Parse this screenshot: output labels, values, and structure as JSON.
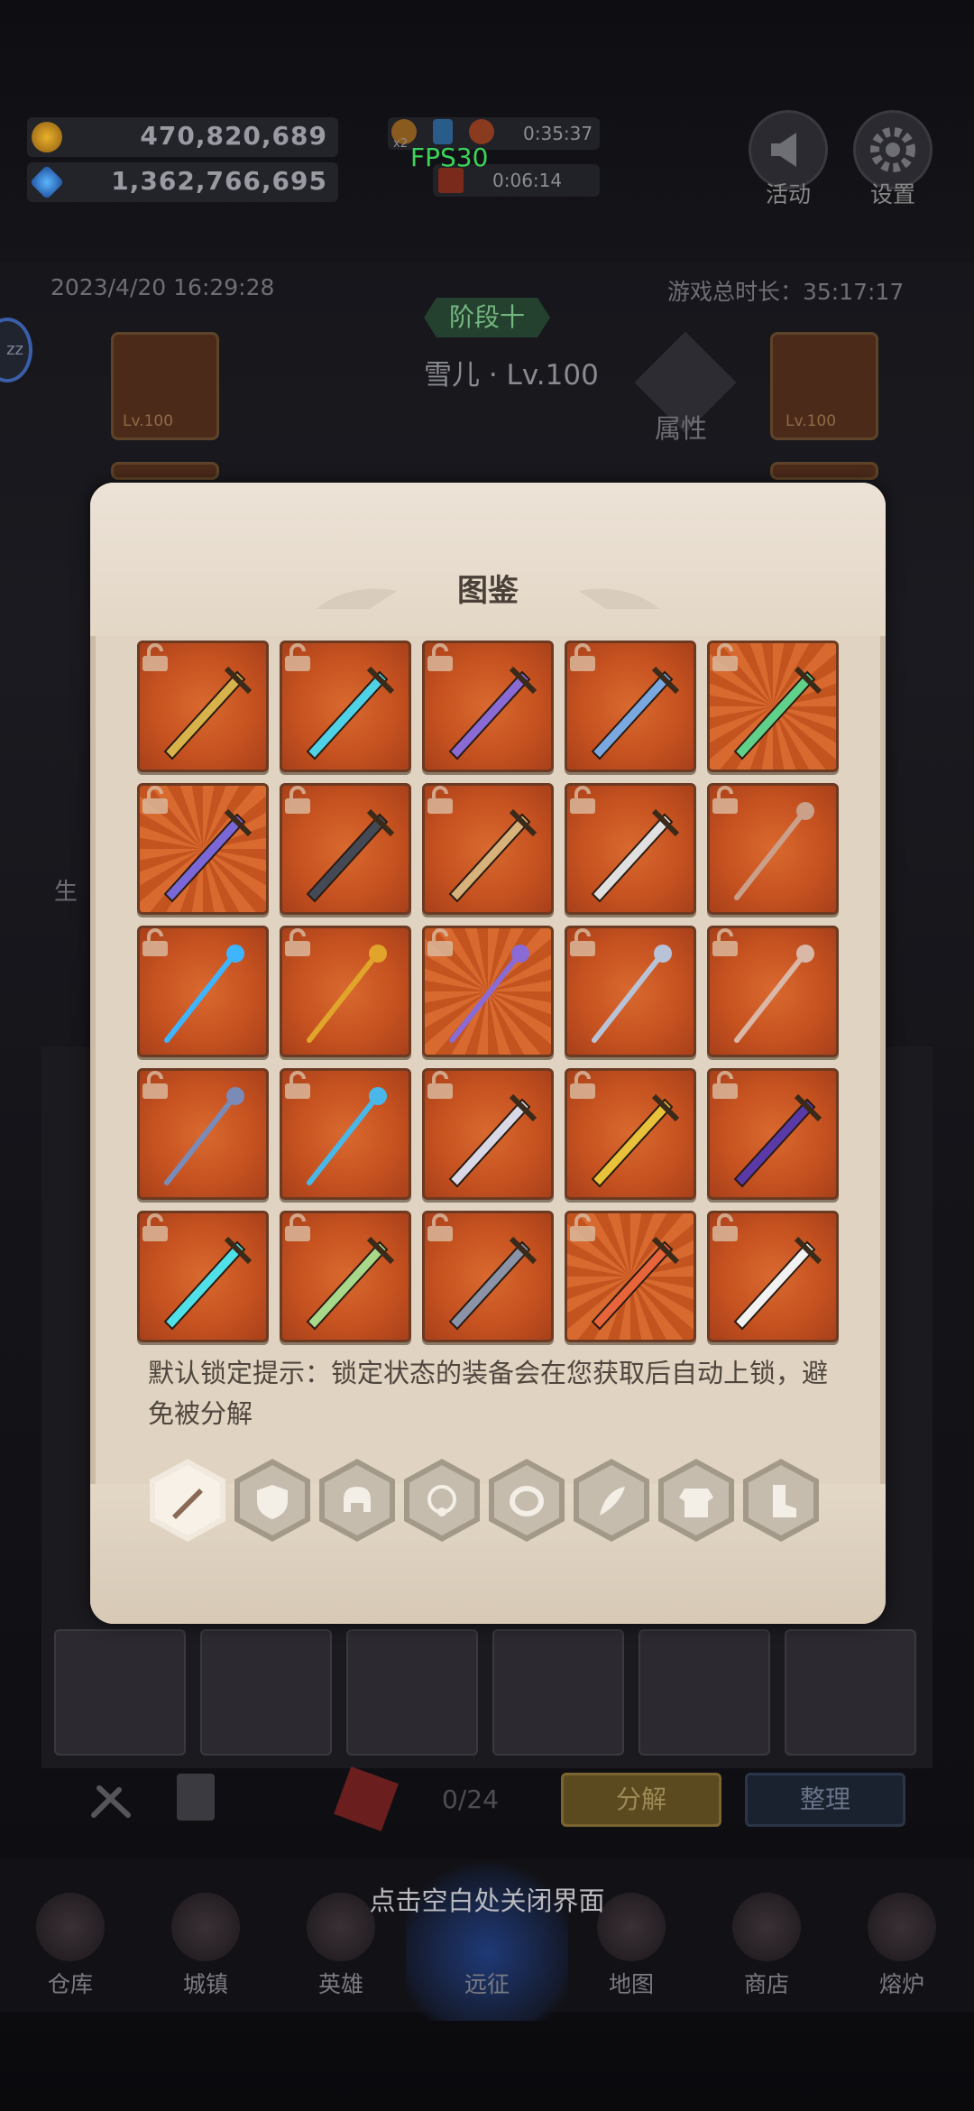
{
  "resources": {
    "gold": "470,820,689",
    "gems": "1,362,766,695"
  },
  "timers": {
    "timer_1": "0:35:37",
    "timer_2": "0:06:14",
    "mult_1": "x2",
    "mult_2": "x2"
  },
  "fps": "FPS30",
  "top_buttons": {
    "activity": "活动",
    "settings": "设置"
  },
  "hero_info": {
    "datetime": "2023/4/20 16:29:28",
    "playtime": "游戏总时长：35:17:17",
    "stage": "阶段十",
    "name": "雪儿 · Lv.100",
    "attr": "属性",
    "left_slot_level": "Lv.100",
    "right_slot_level": "Lv.100",
    "side_bubble": "zz",
    "side_label": "生"
  },
  "modal": {
    "title": "图鉴",
    "tip": "默认锁定提示：锁定状态的装备会在您获取后自动上锁，避免被分解",
    "items": [
      {
        "name": "golden-scimitar",
        "rare": false
      },
      {
        "name": "blue-crystal-sword",
        "rare": false
      },
      {
        "name": "purple-spiked-sword",
        "rare": false
      },
      {
        "name": "blue-spiked-sword",
        "rare": false
      },
      {
        "name": "ornate-green-blade",
        "rare": true
      },
      {
        "name": "purple-great-sword",
        "rare": true
      },
      {
        "name": "dark-iron-sword",
        "rare": false
      },
      {
        "name": "bronze-short-sword",
        "rare": false
      },
      {
        "name": "silver-crescent-blade",
        "rare": false
      },
      {
        "name": "pearl-staff",
        "rare": false
      },
      {
        "name": "blue-orb-staff",
        "rare": false
      },
      {
        "name": "golden-trident-staff",
        "rare": false
      },
      {
        "name": "purple-crystal-staff",
        "rare": true
      },
      {
        "name": "silver-crescent-staff",
        "rare": false
      },
      {
        "name": "red-pearl-staff",
        "rare": false
      },
      {
        "name": "blue-claw-staff",
        "rare": false
      },
      {
        "name": "cyan-orb-staff",
        "rare": false
      },
      {
        "name": "wavy-silver-dagger",
        "rare": false
      },
      {
        "name": "golden-dagger",
        "rare": false
      },
      {
        "name": "purple-curved-blade",
        "rare": false
      },
      {
        "name": "cyan-crystal-dagger",
        "rare": false
      },
      {
        "name": "green-leaf-blade",
        "rare": false
      },
      {
        "name": "twin-fork-blade",
        "rare": false
      },
      {
        "name": "red-flame-knife",
        "rare": true
      },
      {
        "name": "white-cleaver",
        "rare": false
      }
    ],
    "tabs": [
      "weapon",
      "shield",
      "helmet",
      "necklace",
      "ring",
      "feather",
      "armor",
      "boots"
    ]
  },
  "inventory": {
    "count": "0/24",
    "decompose": "分解",
    "sort": "整理"
  },
  "close_hint": "点击空白处关闭界面",
  "nav": [
    "仓库",
    "城镇",
    "英雄",
    "远征",
    "地图",
    "商店",
    "熔炉"
  ],
  "colors": {
    "card_orange": "#c65220",
    "parchment": "#e1d3c1",
    "fps_green": "#3bd35a"
  }
}
